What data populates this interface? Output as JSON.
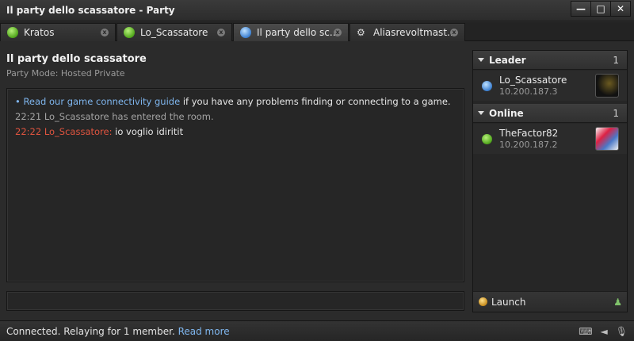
{
  "window": {
    "title": "Il party dello scassatore - Party"
  },
  "window_controls": {
    "minimize": "—",
    "maximize": "□",
    "close": "✕"
  },
  "tabs": [
    {
      "label": "Kratos",
      "icon": "green-status-icon"
    },
    {
      "label": "Lo_Scassatore",
      "icon": "green-status-icon"
    },
    {
      "label": "Il party dello sc...",
      "icon": "party-icon",
      "active": true
    },
    {
      "label": "Aliasrevoltmast...",
      "icon": "gear-icon"
    }
  ],
  "header": {
    "title": "Il party dello scassatore",
    "mode": "Party Mode: Hosted Private"
  },
  "chat": {
    "bullet": "•",
    "guide_link": "Read our game connectivity guide",
    "guide_rest": " if you have any problems finding or connecting to a game.",
    "messages": [
      {
        "time": "22:21",
        "text": "Lo_Scassatore has entered the room."
      },
      {
        "time": "22:22",
        "user": "Lo_Scassatore:",
        "text": "io voglio idiritit"
      }
    ]
  },
  "panel": {
    "leader": {
      "label": "Leader",
      "count": "1",
      "member": {
        "name": "Lo_Scassatore",
        "ip": "10.200.187.3"
      }
    },
    "online": {
      "label": "Online",
      "count": "1",
      "member": {
        "name": "TheFactor82",
        "ip": "10.200.187.2"
      }
    },
    "launch_label": "Launch"
  },
  "statusbar": {
    "text": "Connected. Relaying for 1 member.",
    "read_more": "Read more"
  },
  "colors": {
    "accent_link": "#7fb6ee",
    "chat_user": "#e0543f",
    "online": "#4fa51a",
    "leader": "#3b7fd0"
  }
}
